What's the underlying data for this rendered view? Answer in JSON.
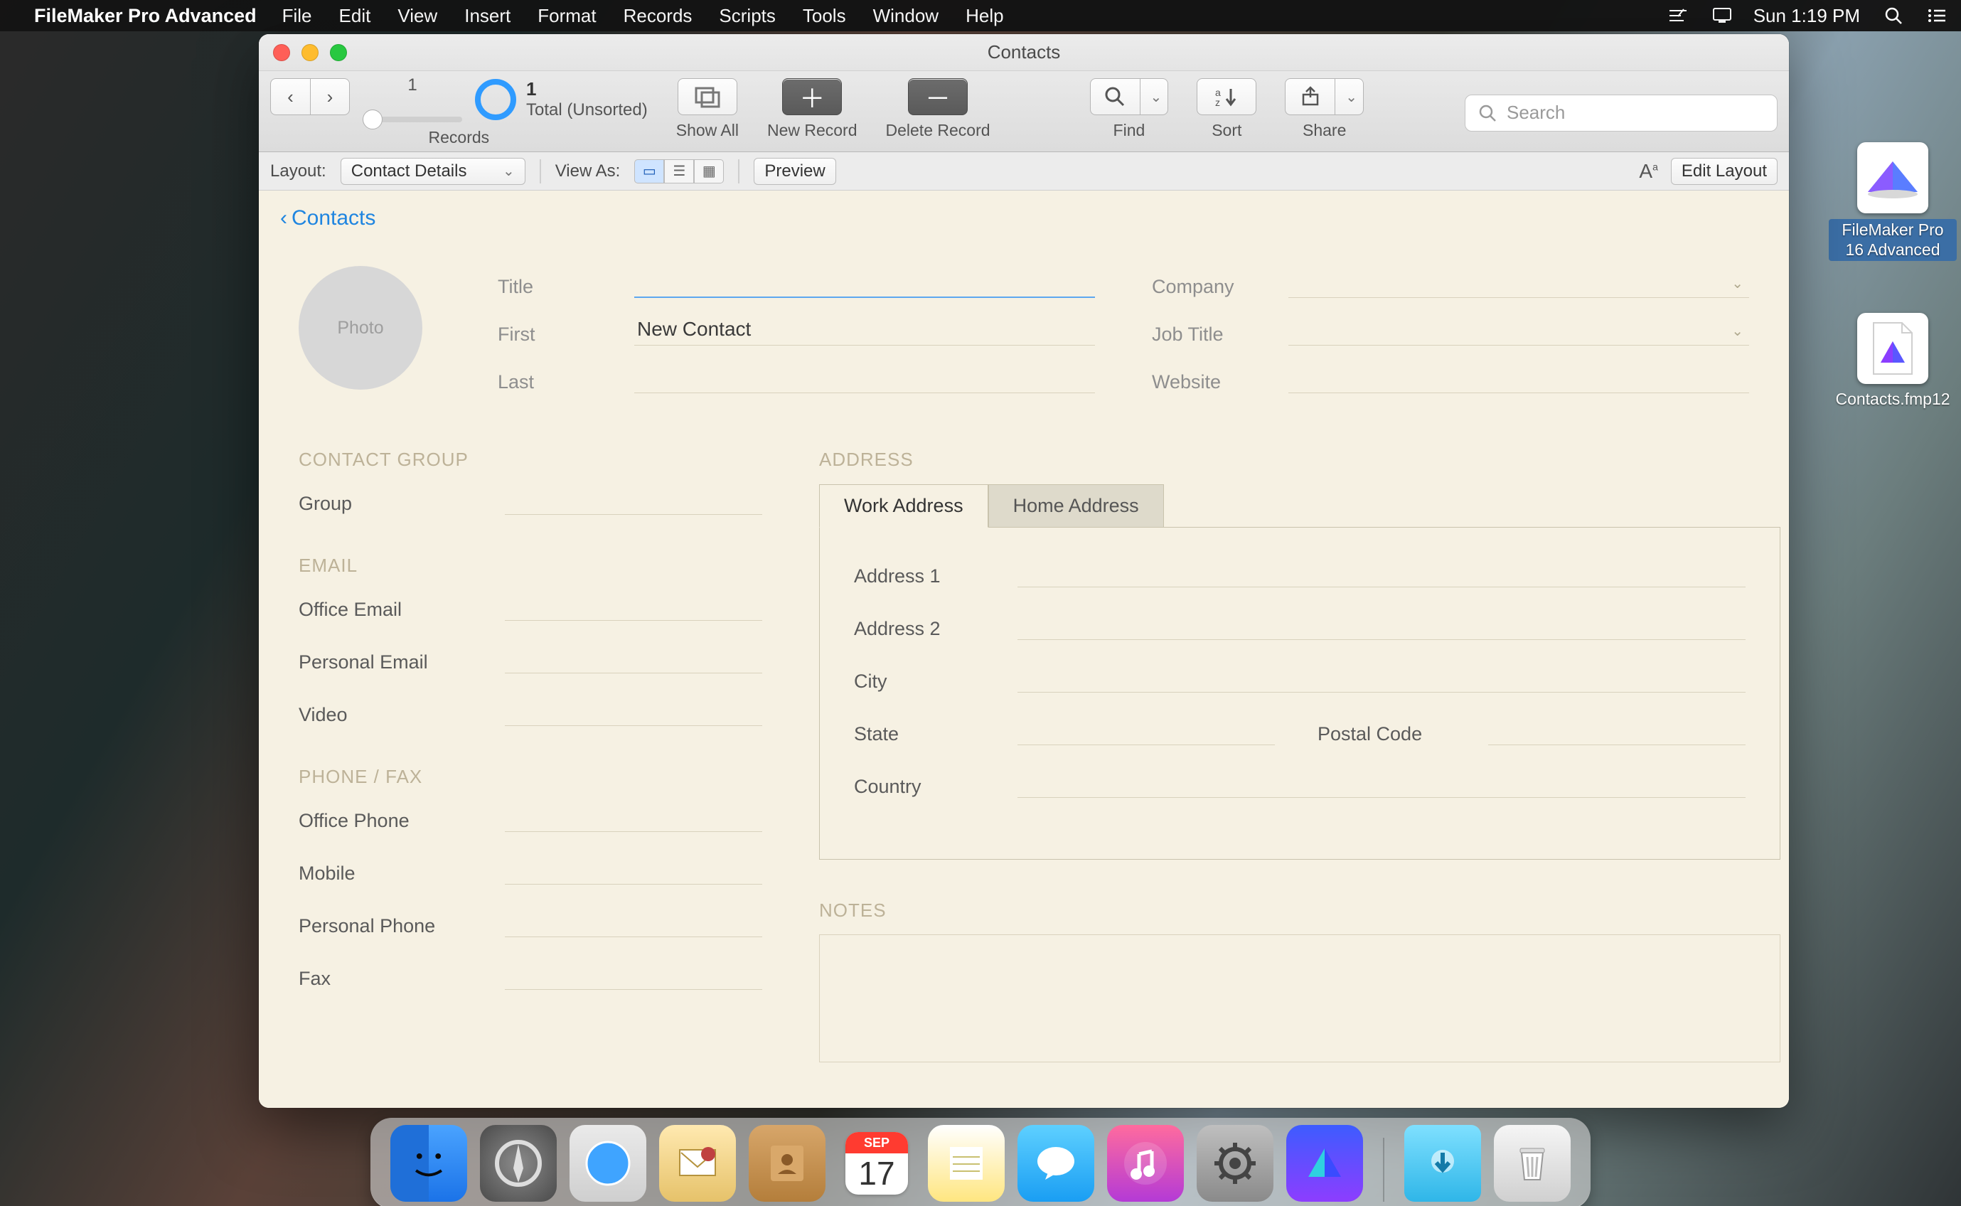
{
  "menubar": {
    "app": "FileMaker Pro Advanced",
    "items": [
      "File",
      "Edit",
      "View",
      "Insert",
      "Format",
      "Records",
      "Scripts",
      "Tools",
      "Window",
      "Help"
    ],
    "clock": "Sun 1:19 PM"
  },
  "desktop_icons": {
    "fm_app": {
      "name": "FileMaker Pro 16 Advanced"
    },
    "file": {
      "name": "Contacts.fmp12"
    }
  },
  "window": {
    "title": "Contacts",
    "toolbar": {
      "record_current": "1",
      "record_total": "1",
      "record_status": "Total (Unsorted)",
      "records_label": "Records",
      "show_all": "Show All",
      "new_record": "New Record",
      "delete_record": "Delete Record",
      "find": "Find",
      "sort": "Sort",
      "share": "Share",
      "search_placeholder": "Search"
    },
    "formatbar": {
      "layout_label": "Layout:",
      "layout_value": "Contact Details",
      "view_as_label": "View As:",
      "preview": "Preview",
      "edit_layout": "Edit Layout"
    },
    "body": {
      "back_link": "Contacts",
      "photo": "Photo",
      "labels": {
        "title": "Title",
        "first": "First",
        "last": "Last",
        "company": "Company",
        "job_title": "Job Title",
        "website": "Website",
        "contact_group_head": "CONTACT GROUP",
        "group": "Group",
        "email_head": "EMAIL",
        "office_email": "Office Email",
        "personal_email": "Personal Email",
        "video": "Video",
        "phone_head": "PHONE / FAX",
        "office_phone": "Office Phone",
        "mobile": "Mobile",
        "personal_phone": "Personal Phone",
        "fax": "Fax",
        "address_head": "ADDRESS",
        "tab_work": "Work Address",
        "tab_home": "Home Address",
        "address1": "Address 1",
        "address2": "Address 2",
        "city": "City",
        "state": "State",
        "postal": "Postal Code",
        "country": "Country",
        "notes_head": "NOTES"
      },
      "values": {
        "first": "New Contact"
      }
    }
  },
  "dock": {
    "cal_month": "SEP",
    "cal_day": "17"
  }
}
